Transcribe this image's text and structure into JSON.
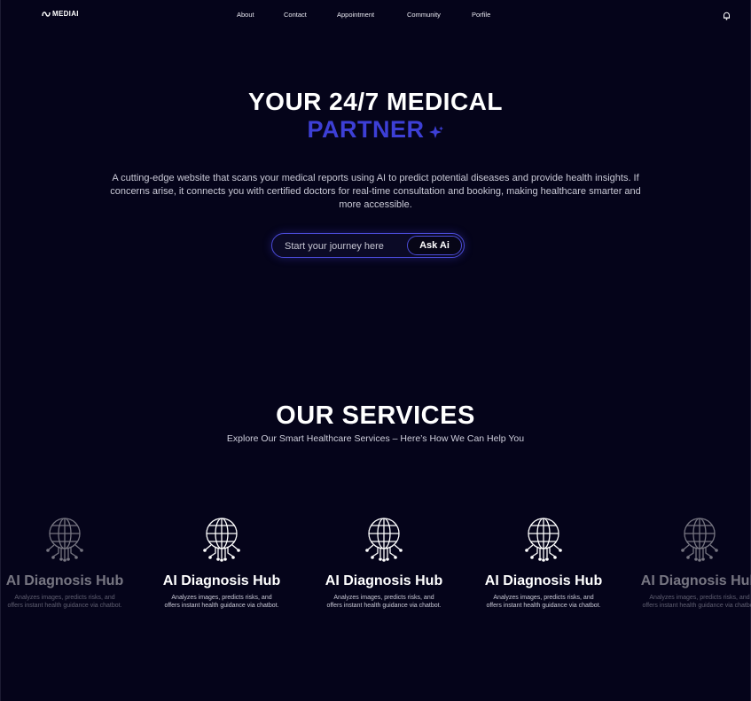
{
  "brand": {
    "logo_text": "MEDIAI"
  },
  "nav": {
    "about": "About",
    "contact": "Contact",
    "appointment": "Appointment",
    "community": "Community",
    "profile": "Porfile"
  },
  "hero": {
    "title": "YOUR 24/7 MEDICAL",
    "accent": "PARTNER",
    "description": "A cutting-edge website that scans your medical reports using AI to predict potential diseases and provide health insights. If concerns arise, it connects you with certified doctors for real-time consultation and booking, making healthcare smarter and more accessible.",
    "search_placeholder": "Start your journey here",
    "ask_button": "Ask Ai"
  },
  "services": {
    "title": "OUR SERVICES",
    "subtitle": "Explore Our Smart Healthcare Services – Here’s How We Can Help You",
    "cards": [
      {
        "title": "AI Diagnosis Hub",
        "description": "Analyzes images, predicts risks, and offers instant health guidance via chatbot.",
        "icon": "globe-network-icon"
      },
      {
        "title": "AI Diagnosis Hub",
        "description": "Analyzes images, predicts risks, and offers instant health guidance via chatbot.",
        "icon": "globe-network-icon"
      },
      {
        "title": "AI Diagnosis Hub",
        "description": "Analyzes images, predicts risks, and offers instant health guidance via chatbot.",
        "icon": "globe-network-icon"
      },
      {
        "title": "AI Diagnosis Hub",
        "description": "Analyzes images, predicts risks, and offers instant health guidance via chatbot.",
        "icon": "globe-network-icon"
      },
      {
        "title": "AI Diagnosis Hub",
        "description": "Analyzes images, predicts risks, and offers instant health guidance via chatbot.",
        "icon": "globe-network-icon"
      }
    ]
  },
  "colors": {
    "background": "#05041a",
    "accent": "#3d3fd6",
    "text": "#ffffff"
  }
}
